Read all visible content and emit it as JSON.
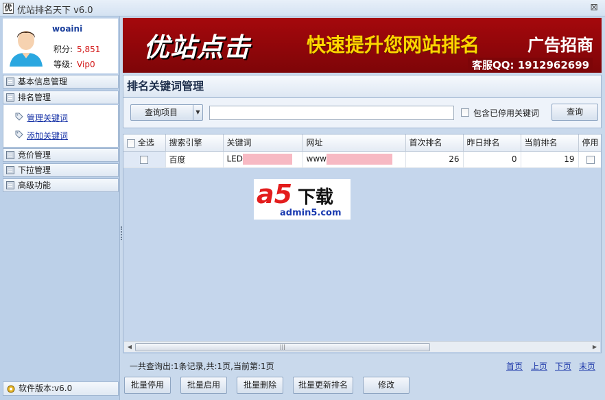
{
  "window": {
    "title": "优站排名天下 v6.0",
    "icon_char": "优",
    "close_glyph": "⊠"
  },
  "user": {
    "name": "woaini",
    "points_label": "积分:",
    "points_value": "5,851",
    "level_label": "等级:",
    "level_value": "Vip0"
  },
  "sidebar": {
    "items": [
      {
        "label": "基本信息管理"
      },
      {
        "label": "排名管理"
      },
      {
        "label": "竞价管理"
      },
      {
        "label": "下拉管理"
      },
      {
        "label": "高级功能"
      }
    ],
    "sub_links": [
      {
        "label": "管理关键词"
      },
      {
        "label": "添加关键词"
      }
    ],
    "version": "软件版本:v6.0"
  },
  "banner": {
    "main": "优站点击",
    "sub": "快速提升您网站排名",
    "ad": "广告招商",
    "qq": "客服QQ: 1912962699"
  },
  "panel": {
    "title": "排名关键词管理"
  },
  "toolbar": {
    "dropdown_label": "查询项目",
    "search_value": "",
    "include_label": "包含已停用关键词",
    "query_label": "查询"
  },
  "table": {
    "select_all": "全选",
    "columns": [
      "搜索引擎",
      "关键词",
      "网址",
      "首次排名",
      "昨日排名",
      "当前排名",
      "停用"
    ],
    "rows": [
      {
        "engine": "百度",
        "keyword": "LED",
        "url": "www",
        "first": "26",
        "yesterday": "0",
        "current": "19"
      }
    ]
  },
  "watermark": {
    "a": "a5",
    "cn": "下载",
    "domain": "admin5.com"
  },
  "footer": {
    "status": "一共查询出:1条记录,共:1页,当前第:1页",
    "pager": [
      "首页",
      "上页",
      "下页",
      "末页"
    ],
    "buttons": [
      "批量停用",
      "批量启用",
      "批量删除",
      "批量更新排名",
      "修改"
    ]
  },
  "colors": {
    "accent": "#1a35a8",
    "banner_bg": "#a5080c",
    "mask": "#f7b9c3",
    "highlight": "#d21414"
  }
}
